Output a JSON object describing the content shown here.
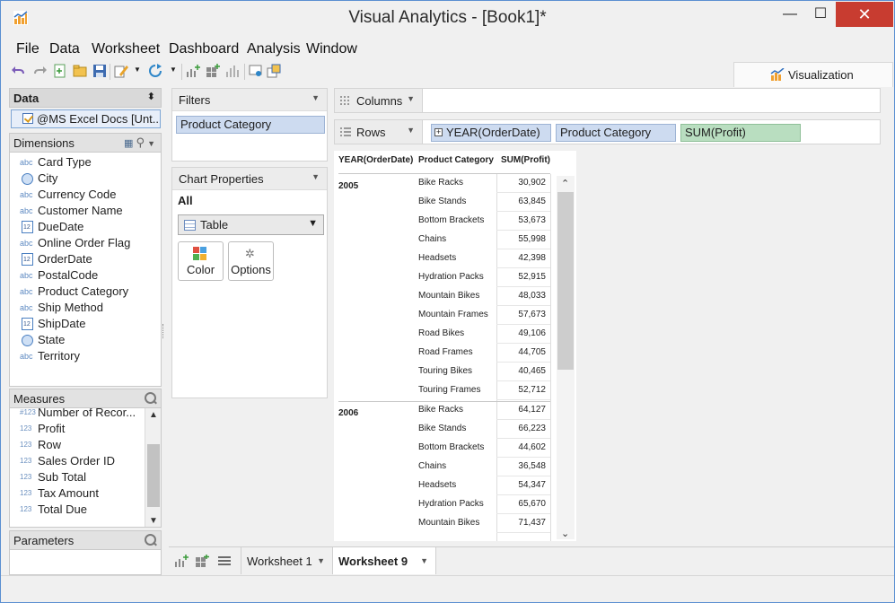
{
  "window": {
    "title": "Visual Analytics - [Book1]*",
    "minimize": "—",
    "maximize": "☐",
    "close": "✕"
  },
  "menu": [
    "File",
    "Data",
    "Worksheet",
    "Dashboard",
    "Analysis",
    "Window"
  ],
  "visualization_tab": "Visualization",
  "data_panel": {
    "header": "Data",
    "datasource": "@MS Excel Docs [Unt..."
  },
  "dimensions": {
    "header": "Dimensions",
    "items": [
      {
        "label": "Card Type",
        "type": "abc"
      },
      {
        "label": "City",
        "type": "geo"
      },
      {
        "label": "Currency Code",
        "type": "abc"
      },
      {
        "label": "Customer Name",
        "type": "abc"
      },
      {
        "label": "DueDate",
        "type": "date"
      },
      {
        "label": "Online Order Flag",
        "type": "abc"
      },
      {
        "label": "OrderDate",
        "type": "date"
      },
      {
        "label": "PostalCode",
        "type": "abc"
      },
      {
        "label": "Product Category",
        "type": "abc"
      },
      {
        "label": "Ship Method",
        "type": "abc"
      },
      {
        "label": "ShipDate",
        "type": "date"
      },
      {
        "label": "State",
        "type": "geo"
      },
      {
        "label": "Territory",
        "type": "abc"
      }
    ]
  },
  "measures": {
    "header": "Measures",
    "items": [
      {
        "label": "Number of Recor...",
        "type": "#123"
      },
      {
        "label": "Profit",
        "type": "123"
      },
      {
        "label": "Row",
        "type": "123"
      },
      {
        "label": "Sales Order ID",
        "type": "123"
      },
      {
        "label": "Sub Total",
        "type": "123"
      },
      {
        "label": "Tax Amount",
        "type": "123"
      },
      {
        "label": "Total Due",
        "type": "123"
      }
    ]
  },
  "parameters": {
    "header": "Parameters"
  },
  "filters": {
    "header": "Filters",
    "items": [
      "Product Category"
    ]
  },
  "chart_properties": {
    "header": "Chart Properties",
    "scope": "All",
    "chart_type": "Table",
    "color_button": "Color",
    "options_button": "Options"
  },
  "shelves": {
    "columns": {
      "label": "Columns",
      "pills": []
    },
    "rows": {
      "label": "Rows",
      "pills": [
        "YEAR(OrderDate)",
        "Product Category",
        "SUM(Profit)"
      ]
    }
  },
  "table": {
    "headers": [
      "YEAR(OrderDate)",
      "Product Category",
      "SUM(Profit)"
    ],
    "groups": [
      {
        "year": "2005",
        "rows": [
          [
            "Bike Racks",
            "30,902"
          ],
          [
            "Bike Stands",
            "63,845"
          ],
          [
            "Bottom Brackets",
            "53,673"
          ],
          [
            "Chains",
            "55,998"
          ],
          [
            "Headsets",
            "42,398"
          ],
          [
            "Hydration Packs",
            "52,915"
          ],
          [
            "Mountain Bikes",
            "48,033"
          ],
          [
            "Mountain Frames",
            "57,673"
          ],
          [
            "Road Bikes",
            "49,106"
          ],
          [
            "Road Frames",
            "44,705"
          ],
          [
            "Touring Bikes",
            "40,465"
          ],
          [
            "Touring Frames",
            "52,712"
          ]
        ]
      },
      {
        "year": "2006",
        "rows": [
          [
            "Bike Racks",
            "64,127"
          ],
          [
            "Bike Stands",
            "66,223"
          ],
          [
            "Bottom Brackets",
            "44,602"
          ],
          [
            "Chains",
            "36,548"
          ],
          [
            "Headsets",
            "54,347"
          ],
          [
            "Hydration Packs",
            "65,670"
          ],
          [
            "Mountain Bikes",
            "71,437"
          ]
        ]
      }
    ]
  },
  "sheet_tabs": [
    {
      "label": "Worksheet 1",
      "active": false
    },
    {
      "label": "Worksheet 9",
      "active": true
    }
  ]
}
